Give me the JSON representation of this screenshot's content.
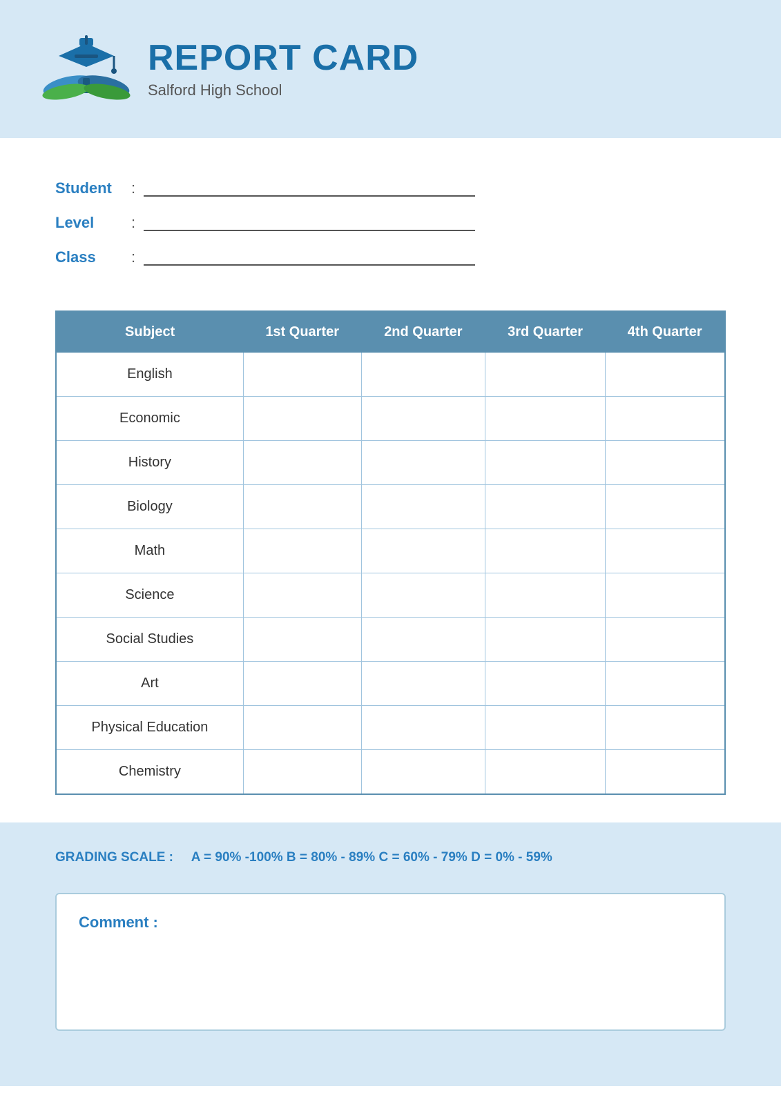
{
  "header": {
    "title": "REPORT CARD",
    "school": "Salford High School"
  },
  "info": {
    "student_label": "Student",
    "level_label": "Level",
    "class_label": "Class"
  },
  "table": {
    "headers": [
      "Subject",
      "1st Quarter",
      "2nd Quarter",
      "3rd Quarter",
      "4th Quarter"
    ],
    "rows": [
      {
        "subject": "English"
      },
      {
        "subject": "Economic"
      },
      {
        "subject": "History"
      },
      {
        "subject": "Biology"
      },
      {
        "subject": "Math"
      },
      {
        "subject": "Science"
      },
      {
        "subject": "Social Studies"
      },
      {
        "subject": "Art"
      },
      {
        "subject": "Physical Education"
      },
      {
        "subject": "Chemistry"
      }
    ]
  },
  "grading": {
    "label": "GRADING SCALE :",
    "scale": "A = 90% -100%  B = 80% - 89%  C = 60% - 79%  D = 0% - 59%"
  },
  "comment": {
    "label": "Comment :"
  }
}
